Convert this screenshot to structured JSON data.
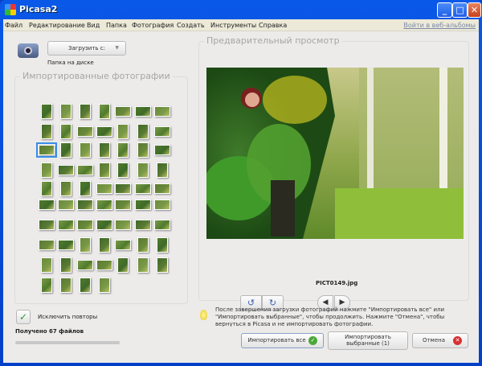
{
  "window": {
    "title": "Picasa2",
    "min": "_",
    "max": "□",
    "close": "✕"
  },
  "menu": [
    "Файл",
    "Редактирование",
    "Вид",
    "Папка",
    "Фотография",
    "Создать",
    "Инструменты",
    "Справка"
  ],
  "web_albums_link": "Войти в веб-альбомы",
  "source": {
    "button_label": "Загрузить с:",
    "arrow": "▼",
    "folder_label": "Папка на диске"
  },
  "imported": {
    "title": "Импортированные фотографии",
    "selected_index": 14
  },
  "preview": {
    "title": "Предварительный просмотр",
    "filename": "PICT0149.jpg",
    "rotate_left": "↺",
    "rotate_right": "↻",
    "prev": "◀",
    "next": "▶"
  },
  "exclude_duplicates": {
    "label": "Исключить повторы",
    "checked": true,
    "mark": "✓"
  },
  "status": {
    "received": "Получено 67 файлов",
    "progress": 1.0
  },
  "hint": "После завершения загрузки фотографий нажмите \"Импортировать все\" или \"Импортировать выбранные\", чтобы продолжить. Нажмите \"Отмена\", чтобы вернуться в Picasa и не импортировать фотографии.",
  "buttons": {
    "import_all": "Импортировать все",
    "import_selected": "Импортировать выбранные (1)",
    "cancel": "Отмена"
  }
}
